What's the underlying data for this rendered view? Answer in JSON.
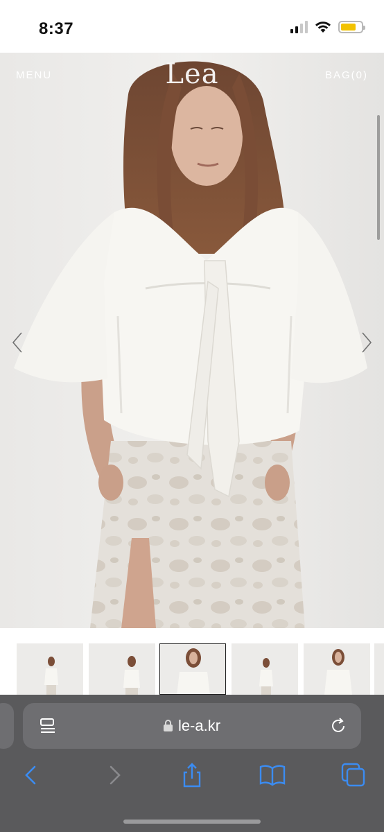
{
  "status_bar": {
    "time": "8:37",
    "battery_level": 0.75,
    "signal_bars_active": 2,
    "signal_bars_total": 4
  },
  "site": {
    "menu_label": "MENU",
    "logo_text": "Lea",
    "bag_label": "BAG(0)",
    "prev_arrow": "‹",
    "next_arrow": "›"
  },
  "thumbnails": {
    "count": 6,
    "active_index": 2
  },
  "browser": {
    "url": "le-a.kr",
    "icons": [
      "reader-icon",
      "lock-icon",
      "reload-icon",
      "back-icon",
      "forward-icon",
      "share-icon",
      "bookmarks-icon",
      "tabs-icon"
    ]
  },
  "colors": {
    "safari_bar": "#5a5a5c",
    "url_field": "#6e6e71",
    "ios_blue": "#3b8cf2",
    "battery": "#f2c200"
  }
}
